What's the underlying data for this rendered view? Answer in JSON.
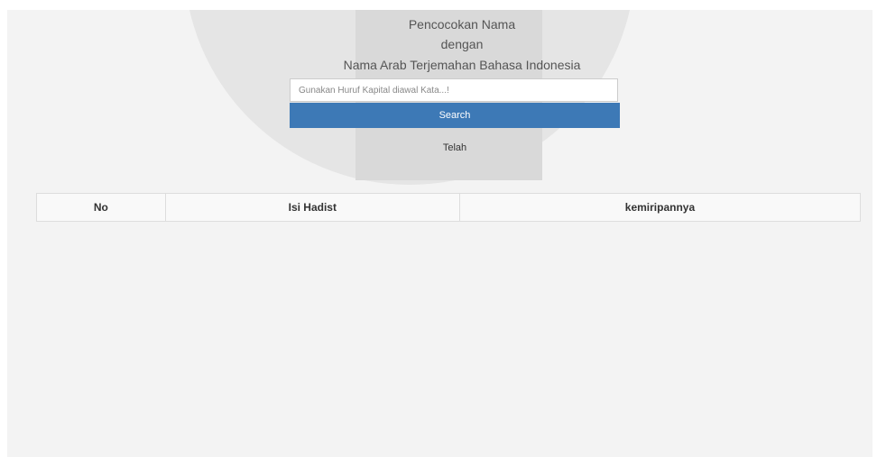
{
  "header": {
    "line1": "Pencocokan Nama",
    "line2": "dengan",
    "line3": "Nama Arab Terjemahan Bahasa Indonesia"
  },
  "search": {
    "placeholder": "Gunakan Huruf Kapital diawal Kata...!",
    "value": "",
    "button_label": "Search"
  },
  "status": {
    "text": "Telah"
  },
  "table": {
    "columns": [
      "No",
      "Isi Hadist",
      "kemiripannya"
    ],
    "rows": []
  },
  "colors": {
    "button_bg": "#3d79b6",
    "panel_bg": "#f3f3f3"
  }
}
